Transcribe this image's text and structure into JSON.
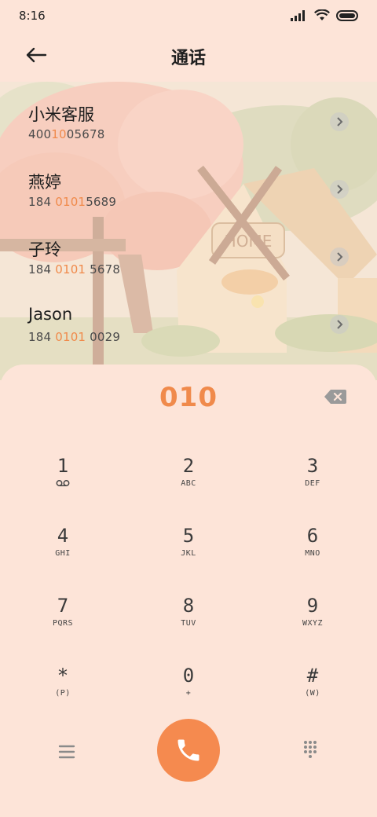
{
  "status_bar": {
    "time": "8:16",
    "icons": [
      "signal-icon",
      "wifi-icon",
      "battery-icon"
    ]
  },
  "header": {
    "title": "通话",
    "back_icon": "back-arrow-icon"
  },
  "contacts": [
    {
      "name": "小米客服",
      "number_parts": [
        "400",
        "10",
        "05678"
      ]
    },
    {
      "name": "燕婷",
      "number_parts": [
        "184 ",
        "0101",
        "5689"
      ]
    },
    {
      "name": "子玲",
      "number_parts": [
        "184 ",
        "0101",
        " 5678"
      ]
    },
    {
      "name": "Jason",
      "number_parts": [
        "184 ",
        "0101",
        " 0029"
      ]
    }
  ],
  "dialer": {
    "number": "010",
    "keys": [
      {
        "digit": "1",
        "sub": "voicemail-icon"
      },
      {
        "digit": "2",
        "sub": "ABC"
      },
      {
        "digit": "3",
        "sub": "DEF"
      },
      {
        "digit": "4",
        "sub": "GHI"
      },
      {
        "digit": "5",
        "sub": "JKL"
      },
      {
        "digit": "6",
        "sub": "MNO"
      },
      {
        "digit": "7",
        "sub": "PQRS"
      },
      {
        "digit": "8",
        "sub": "TUV"
      },
      {
        "digit": "9",
        "sub": "WXYZ"
      },
      {
        "digit": "*",
        "sub": "(P)"
      },
      {
        "digit": "0",
        "sub": "+"
      },
      {
        "digit": "#",
        "sub": "(W)"
      }
    ],
    "call_icon": "phone-icon",
    "menu_icon": "menu-icon",
    "keypad_icon": "keypad-icon"
  },
  "colors": {
    "accent": "#f08a4b",
    "background": "#fde4d8",
    "call_button": "#f58a4f"
  }
}
